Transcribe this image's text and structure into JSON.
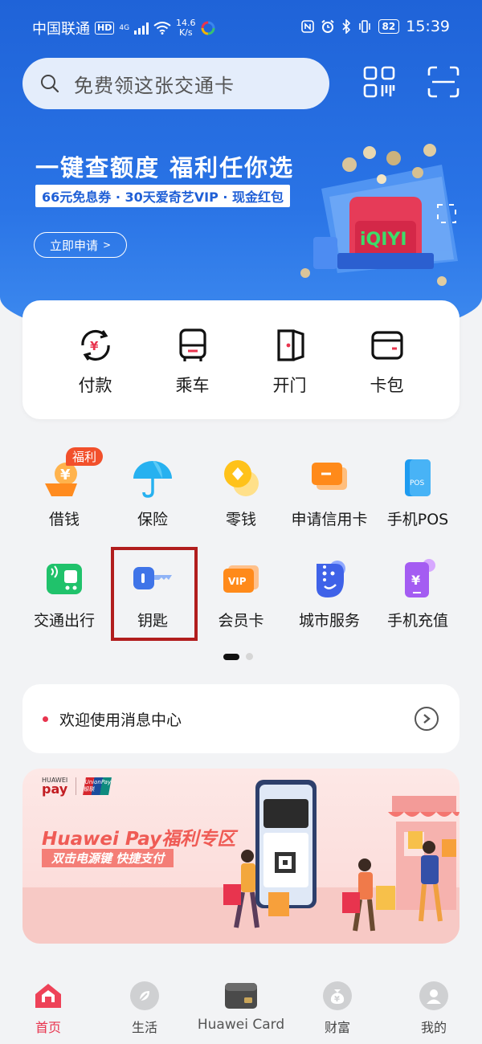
{
  "status_bar": {
    "carrier": "中国联通",
    "hd": "HD",
    "net_type": "4G",
    "speed_value": "14.6",
    "speed_unit": "K/s",
    "battery": "82",
    "time": "15:39"
  },
  "search": {
    "placeholder": "免费领这张交通卡"
  },
  "banner": {
    "title": "一键查额度  福利任你选",
    "subtitle": "66元免息券 · 30天爱奇艺VIP · 现金红包",
    "button_label": "立即申请",
    "button_arrow": ">"
  },
  "quick_actions": [
    {
      "label": "付款",
      "icon": "pay-icon"
    },
    {
      "label": "乘车",
      "icon": "bus-icon"
    },
    {
      "label": "开门",
      "icon": "door-icon"
    },
    {
      "label": "卡包",
      "icon": "card-wallet-icon"
    }
  ],
  "services": [
    {
      "label": "借钱",
      "icon": "loan-icon"
    },
    {
      "label": "保险",
      "icon": "umbrella-icon"
    },
    {
      "label": "零钱",
      "icon": "coin-icon"
    },
    {
      "label": "申请信用卡",
      "icon": "credit-card-icon"
    },
    {
      "label": "手机POS",
      "icon": "pos-icon"
    },
    {
      "label": "交通出行",
      "icon": "transit-icon"
    },
    {
      "label": "钥匙",
      "icon": "key-icon"
    },
    {
      "label": "会员卡",
      "icon": "vip-card-icon"
    },
    {
      "label": "城市服务",
      "icon": "city-service-icon"
    },
    {
      "label": "手机充值",
      "icon": "phone-recharge-icon"
    }
  ],
  "badge_fuli": "福利",
  "pos_text": "POS",
  "vip_text": "VIP",
  "message": {
    "text": "欢迎使用消息中心"
  },
  "pay_banner": {
    "brand_hw": "HUAWEI",
    "brand_pay": "pay",
    "brand_unionpay": "UnionPay 银联",
    "title": "Huawei Pay福利专区",
    "subtitle": "双击电源键  快捷支付"
  },
  "nav": [
    {
      "label": "首页",
      "icon": "home-icon",
      "active": true
    },
    {
      "label": "生活",
      "icon": "life-icon",
      "active": false
    },
    {
      "label": "Huawei Card",
      "icon": "huawei-card-icon",
      "active": false
    },
    {
      "label": "财富",
      "icon": "wealth-icon",
      "active": false
    },
    {
      "label": "我的",
      "icon": "profile-icon",
      "active": false
    }
  ],
  "colors": {
    "brand_blue": "#2a74e6",
    "accent_red": "#e8344e",
    "highlight_border": "#b11d1d"
  }
}
